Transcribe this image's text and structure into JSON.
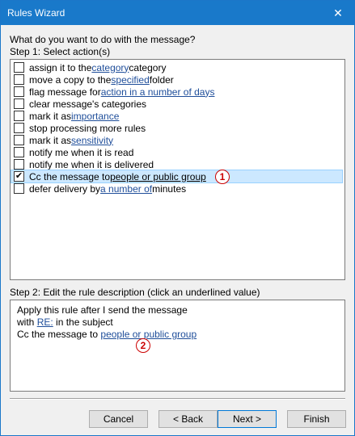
{
  "window": {
    "title": "Rules Wizard",
    "close_glyph": "✕"
  },
  "question": "What do you want to do with the message?",
  "step1_label": "Step 1: Select action(s)",
  "actions": [
    {
      "pre": "assign it to the ",
      "link": "category",
      "post": " category",
      "checked": false
    },
    {
      "pre": "move a copy to the ",
      "link": "specified",
      "post": " folder",
      "checked": false
    },
    {
      "pre": "flag message for ",
      "link": "action in a number of days",
      "post": "",
      "checked": false
    },
    {
      "pre": "clear message's categories",
      "link": "",
      "post": "",
      "checked": false
    },
    {
      "pre": "mark it as ",
      "link": "importance",
      "post": "",
      "checked": false
    },
    {
      "pre": "stop processing more rules",
      "link": "",
      "post": "",
      "checked": false
    },
    {
      "pre": "mark it as ",
      "link": "sensitivity",
      "post": "",
      "checked": false
    },
    {
      "pre": "notify me when it is read",
      "link": "",
      "post": "",
      "checked": false
    },
    {
      "pre": "notify me when it is delivered",
      "link": "",
      "post": "",
      "checked": false
    },
    {
      "pre": "Cc the message to ",
      "link": "people or public group",
      "post": "",
      "checked": true
    },
    {
      "pre": "defer delivery by ",
      "link": "a number of",
      "post": " minutes",
      "checked": false
    }
  ],
  "badge1": "1",
  "badge2": "2",
  "step2_label": "Step 2: Edit the rule description (click an underlined value)",
  "description": {
    "line1": "Apply this rule after I send the message",
    "line2_pre": "with ",
    "line2_link": "RE:",
    "line2_post": " in the subject",
    "line3_pre": "Cc the message to ",
    "line3_link": "people or public group"
  },
  "buttons": {
    "cancel": "Cancel",
    "back": "< Back",
    "next": "Next >",
    "finish": "Finish"
  },
  "colors": {
    "titlebar": "#1979ca",
    "link": "#1f4e9a",
    "selection": "#cce8ff",
    "badge": "#cc0000"
  }
}
